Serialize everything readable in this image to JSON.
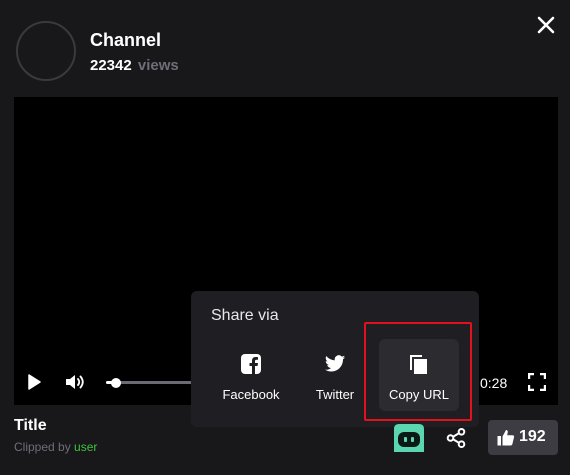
{
  "channel": {
    "name": "Channel",
    "views_count": "22342",
    "views_label": "views"
  },
  "player": {
    "time": "0:28",
    "progress": 0.11
  },
  "share_popup": {
    "title": "Share via",
    "options": [
      {
        "label": "Facebook",
        "icon": "facebook-icon"
      },
      {
        "label": "Twitter",
        "icon": "twitter-icon"
      },
      {
        "label": "Copy URL",
        "icon": "copy-icon"
      }
    ],
    "highlight_color": "#e3101d"
  },
  "clip": {
    "title": "Title",
    "clipped_by_prefix": "Clipped by",
    "user": "user"
  },
  "actions": {
    "like_count": "192"
  },
  "colors": {
    "background": "#18181b",
    "accent_green": "#3ec23e",
    "robot_teal": "#5cd6b0"
  }
}
